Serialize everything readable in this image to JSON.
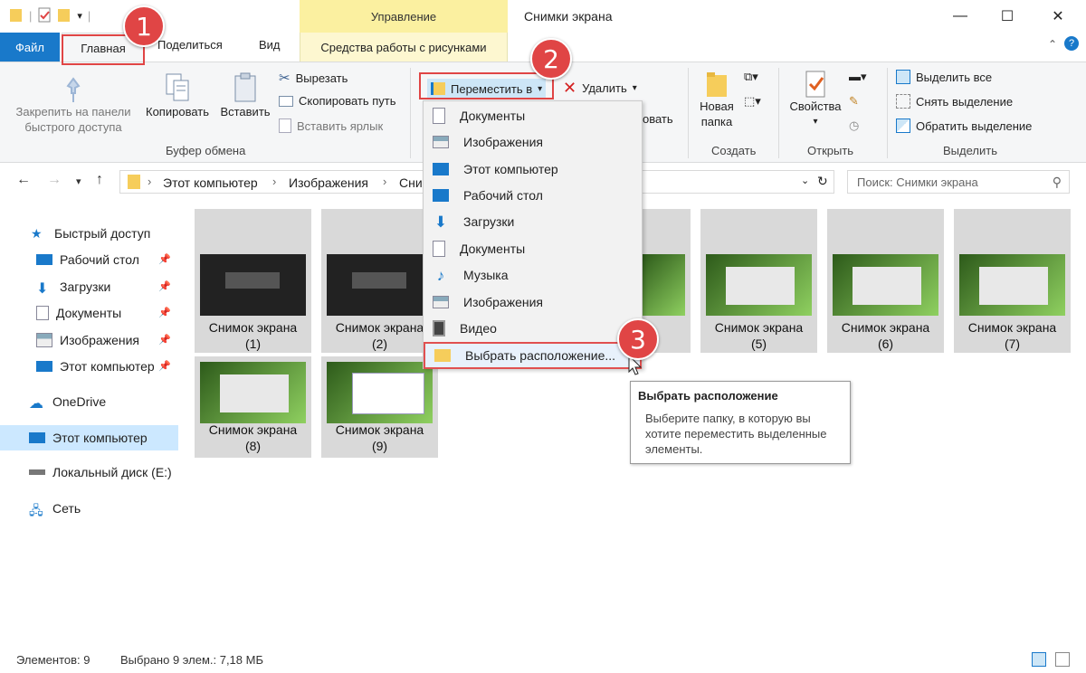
{
  "window": {
    "context_group": "Управление",
    "title": "Снимки экрана",
    "controls": {
      "minimize": "—",
      "maximize": "☐",
      "close": "✕"
    }
  },
  "tabs": {
    "file": "Файл",
    "home": "Главная",
    "share": "Поделиться",
    "view": "Вид",
    "picture_tools": "Средства работы с рисунками"
  },
  "ribbon": {
    "clipboard": {
      "pin": "Закрепить на панели\nбыстрого доступа",
      "copy": "Копировать",
      "paste": "Вставить",
      "cut": "Вырезать",
      "copy_path": "Скопировать путь",
      "paste_shortcut": "Вставить ярлык",
      "label": "Буфер обмена"
    },
    "organize": {
      "move_to": "Переместить в",
      "delete": "Удалить",
      "rename_partial": "овать"
    },
    "new": {
      "new_folder": "Новая\nпапка",
      "label": "Создать"
    },
    "open": {
      "properties": "Свойства",
      "label": "Открыть"
    },
    "select": {
      "select_all": "Выделить все",
      "select_none": "Снять выделение",
      "invert": "Обратить выделение",
      "label": "Выделить"
    }
  },
  "address": {
    "crumbs": [
      "Этот компьютер",
      "Изображения",
      "Сни"
    ],
    "search_placeholder": "Поиск: Снимки экрана"
  },
  "sidebar": {
    "items": [
      {
        "label": "Быстрый доступ",
        "icon": "star-icon"
      },
      {
        "label": "Рабочий стол",
        "icon": "desktop-icon",
        "pinned": true
      },
      {
        "label": "Загрузки",
        "icon": "download-icon",
        "pinned": true
      },
      {
        "label": "Документы",
        "icon": "document-icon",
        "pinned": true
      },
      {
        "label": "Изображения",
        "icon": "pictures-icon",
        "pinned": true
      },
      {
        "label": "Этот компьютер",
        "icon": "computer-icon",
        "pinned": true
      },
      {
        "label": "OneDrive",
        "icon": "cloud-icon"
      },
      {
        "label": "Этот компьютер",
        "icon": "computer-icon",
        "selected": true
      },
      {
        "label": "Локальный диск (E:)",
        "icon": "drive-icon"
      },
      {
        "label": "Сеть",
        "icon": "network-icon"
      }
    ]
  },
  "files": [
    {
      "name": "Снимок экрана",
      "num": "(1)"
    },
    {
      "name": "Снимок экрана",
      "num": "(2)"
    },
    {
      "name": "Снимок экрана",
      "num": "(5)"
    },
    {
      "name": "Снимок экрана",
      "num": "(6)"
    },
    {
      "name": "Снимок экрана",
      "num": "(7)"
    },
    {
      "name": "Снимок экрана",
      "num": "(8)"
    },
    {
      "name": "Снимок экрана",
      "num": "(9)"
    }
  ],
  "dropdown": {
    "items": [
      {
        "label": "Документы",
        "icon": "document-icon"
      },
      {
        "label": "Изображения",
        "icon": "pictures-icon"
      },
      {
        "label": "Этот компьютер",
        "icon": "computer-icon"
      },
      {
        "label": "Рабочий стол",
        "icon": "desktop-icon"
      },
      {
        "label": "Загрузки",
        "icon": "download-icon"
      },
      {
        "label": "Документы",
        "icon": "document-icon"
      },
      {
        "label": "Музыка",
        "icon": "music-icon"
      },
      {
        "label": "Изображения",
        "icon": "pictures-icon"
      },
      {
        "label": "Видео",
        "icon": "video-icon"
      }
    ],
    "choose": "Выбрать расположение..."
  },
  "tooltip": {
    "title": "Выбрать расположение",
    "body": "Выберите папку, в которую вы хотите переместить выделенные элементы."
  },
  "callouts": [
    "1",
    "2",
    "3"
  ],
  "status": {
    "count": "Элементов: 9",
    "selected": "Выбрано 9 элем.: 7,18 МБ"
  },
  "colors": {
    "accent": "#1979ca",
    "callout": "#e04545",
    "context_tab": "#fbf0a0",
    "selection": "#cce8ff"
  }
}
